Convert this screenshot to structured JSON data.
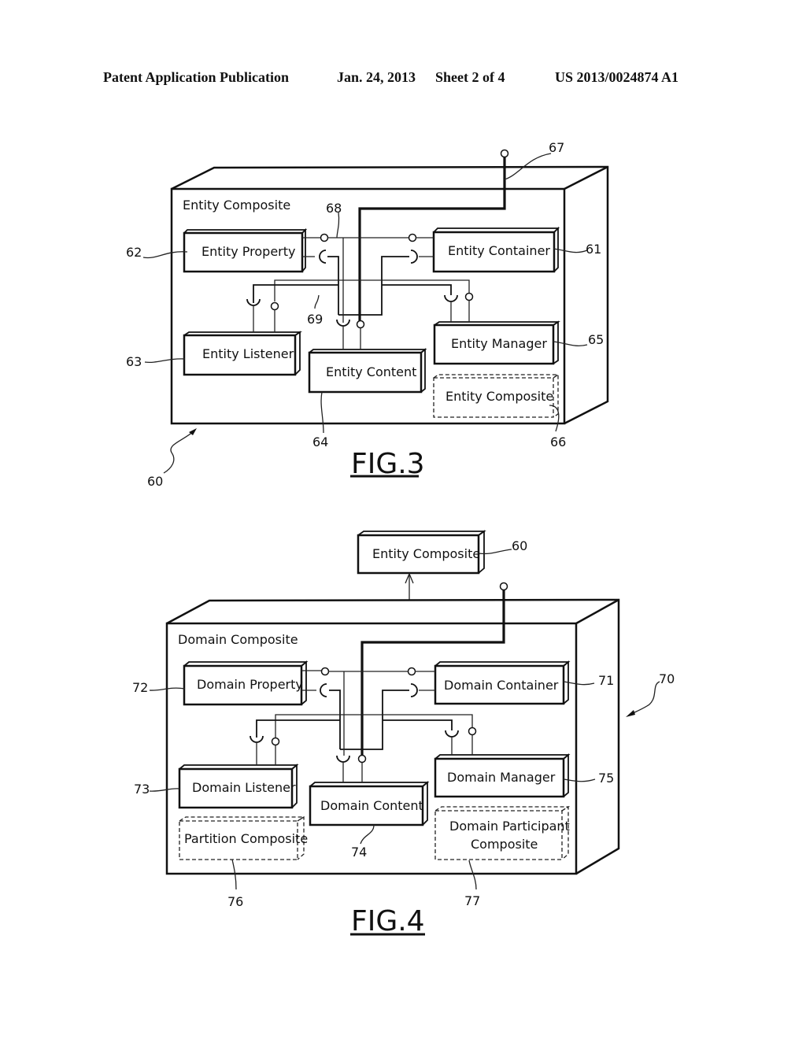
{
  "header": {
    "publication": "Patent Application Publication",
    "date": "Jan. 24, 2013",
    "sheet": "Sheet 2 of 4",
    "number": "US 2013/0024874 A1"
  },
  "fig3": {
    "caption": "FIG.3",
    "outer_label": "Entity Composite",
    "outer_ref": "60",
    "components": {
      "property": {
        "label": "Entity Property",
        "ref": "62"
      },
      "container": {
        "label": "Entity Container",
        "ref": "61"
      },
      "listener": {
        "label": "Entity Listener",
        "ref": "63"
      },
      "content": {
        "label": "Entity Content",
        "ref": "64"
      },
      "manager": {
        "label": "Entity Manager",
        "ref": "65"
      },
      "composite": {
        "label": "Entity Composite",
        "ref": "66",
        "style": "dashed"
      }
    },
    "bus_ref": "67",
    "wire_refs": {
      "provided_interface": "68",
      "required_interface": "69"
    }
  },
  "fig4": {
    "caption": "FIG.4",
    "outer_label": "Domain Composite",
    "outer_ref": "70",
    "parent": {
      "label": "Entity Composite",
      "ref": "60"
    },
    "components": {
      "property": {
        "label": "Domain Property",
        "ref": "72"
      },
      "container": {
        "label": "Domain Container",
        "ref": "71"
      },
      "listener": {
        "label": "Domain Listener",
        "ref": "73"
      },
      "content": {
        "label": "Domain Content",
        "ref": "74"
      },
      "manager": {
        "label": "Domain Manager",
        "ref": "75"
      },
      "partition": {
        "label": "Partition Composite",
        "ref": "76",
        "style": "dashed"
      },
      "participant": {
        "label_line1": "Domain Participant",
        "label_line2": "Composite",
        "ref": "77",
        "style": "dashed"
      }
    }
  }
}
